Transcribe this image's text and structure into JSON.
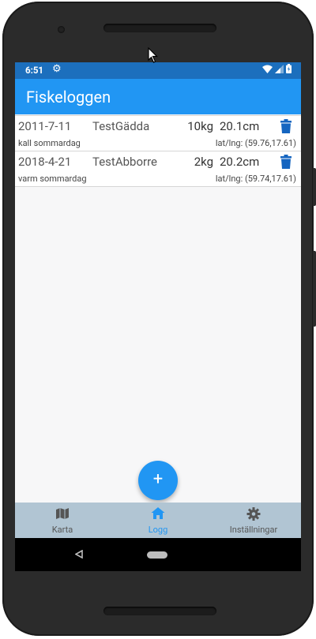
{
  "status_bar": {
    "time": "6:51"
  },
  "app_bar": {
    "title": "Fiskeloggen"
  },
  "entries": [
    {
      "date": "2011-7-11",
      "name": "TestGädda",
      "weight": "10kg",
      "length": "20.1cm",
      "description": "kall sommardag",
      "coords": "lat/lng: (59.76,17.61)"
    },
    {
      "date": "2018-4-21",
      "name": "TestAbborre",
      "weight": "2kg",
      "length": "20.2cm",
      "description": "varm sommardag",
      "coords": "lat/lng: (59.74,17.61)"
    }
  ],
  "fab": {
    "label": "+"
  },
  "bottom_nav": {
    "items": [
      {
        "label": "Karta",
        "icon": "map-icon",
        "active": false
      },
      {
        "label": "Logg",
        "icon": "home-icon",
        "active": true
      },
      {
        "label": "Inställningar",
        "icon": "settings-icon",
        "active": false
      }
    ]
  },
  "colors": {
    "primary": "#2196f3",
    "status_bar": "#1c6fbd",
    "bottom_nav": "#b1c5d3",
    "trash": "#1565c0"
  }
}
